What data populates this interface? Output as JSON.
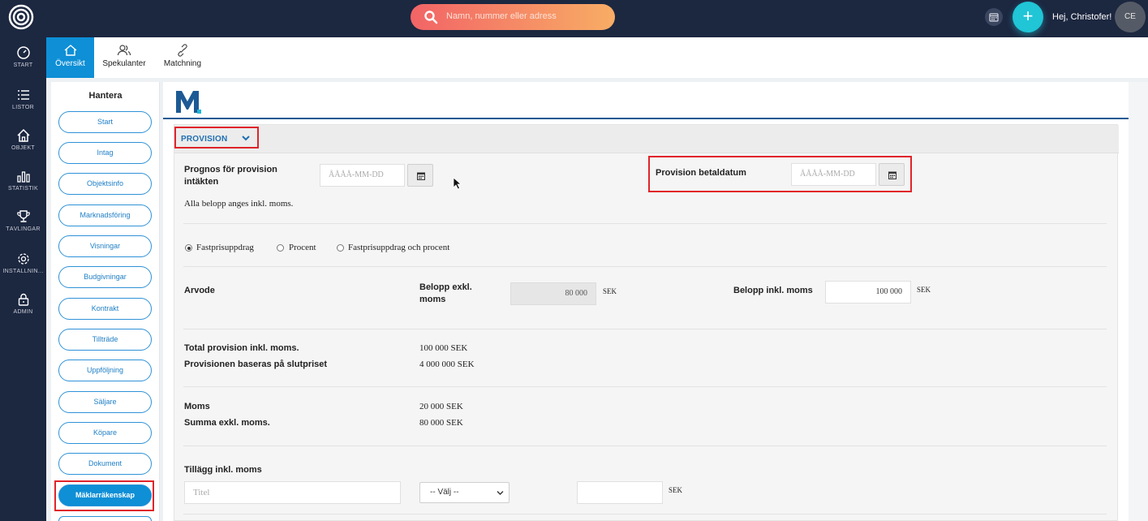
{
  "topbar": {
    "search_placeholder": "Namn, nummer eller adress",
    "plus_label": "+",
    "greeting": "Hej, Christofer!",
    "avatar_initials": "CE",
    "colors": {
      "bg": "#1c2740",
      "accent": "#20c5d6"
    }
  },
  "rail": {
    "items": [
      {
        "label": "START",
        "icon": "speedometer-icon"
      },
      {
        "label": "LISTOR",
        "icon": "list-icon"
      },
      {
        "label": "OBJEKT",
        "icon": "house-icon"
      },
      {
        "label": "STATISTIK",
        "icon": "bar-chart-icon"
      },
      {
        "label": "TÄVLINGAR",
        "icon": "trophy-icon"
      },
      {
        "label": "INSTÄLLNIN...",
        "icon": "gear-icon"
      },
      {
        "label": "ADMIN",
        "icon": "lock-icon"
      }
    ]
  },
  "subnav": {
    "tabs": [
      {
        "label": "Översikt",
        "icon": "home-icon",
        "active": true
      },
      {
        "label": "Spekulanter",
        "icon": "users-icon",
        "active": false
      },
      {
        "label": "Matchning",
        "icon": "link-icon",
        "active": false
      }
    ]
  },
  "manage": {
    "title": "Hantera",
    "items": [
      "Start",
      "Intag",
      "Objektsinfo",
      "Marknadsföring",
      "Visningar",
      "Budgivningar",
      "Kontrakt",
      "Tillträde",
      "Uppföljning",
      "Säljare",
      "Köpare",
      "Dokument",
      "Mäklarräkenskap"
    ],
    "active": "Mäklarräkenskap"
  },
  "provision": {
    "section_label": "PROVISION",
    "forecast_label": "Prognos för provision intäkten",
    "forecast_placeholder": "ÅÅÅÅ-MM-DD",
    "payment_date_label": "Provision betaldatum",
    "payment_date_placeholder": "ÅÅÅÅ-MM-DD",
    "vat_note": "Alla belopp anges inkl. moms.",
    "fee_options": [
      "Fastprisuppdrag",
      "Procent",
      "Fastprisuppdrag och procent"
    ],
    "fee_selected": "Fastprisuppdrag",
    "fee_label": "Arvode",
    "amount_excl_label": "Belopp exkl. moms",
    "amount_excl_value": "80 000",
    "currency": "SEK",
    "amount_incl_label": "Belopp inkl. moms",
    "amount_incl_value": "100 000",
    "total_label": "Total provision inkl. moms.",
    "total_value": "100 000 SEK",
    "based_on_label": "Provisionen baseras på slutpriset",
    "based_on_value": "4 000 000 SEK",
    "moms_label": "Moms",
    "moms_value": "20 000 SEK",
    "sum_excl_label": "Summa exkl. moms.",
    "sum_excl_value": "80 000 SEK",
    "addition_label": "Tillägg inkl. moms",
    "title_placeholder": "Titel",
    "select_value": "-- Välj --"
  }
}
